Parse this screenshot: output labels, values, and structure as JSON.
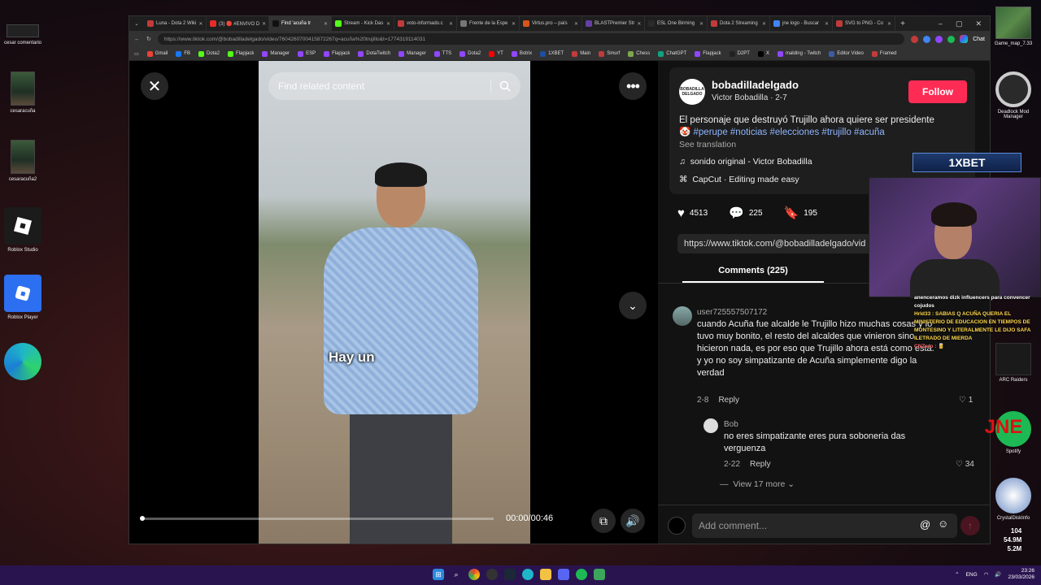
{
  "desktop": {
    "icons": [
      {
        "label": "cesar comentario"
      },
      {
        "label": "cesaracuña"
      },
      {
        "label": "cesaracuña2"
      },
      {
        "label": "Roblox Studio"
      },
      {
        "label": "Roblox Player"
      },
      {
        "label": "Game_map_7.33"
      },
      {
        "label": "Deadlock Mod Manager"
      },
      {
        "label": "ARC Raiders"
      },
      {
        "label": "Spotify"
      },
      {
        "label": "CrystalDiskInfo"
      }
    ]
  },
  "browser": {
    "tabs": [
      {
        "label": "Luna - Dota 2 Wiki",
        "color": "#c23b3b"
      },
      {
        "label": "(3) 🔴 #ENVIVO D",
        "color": "#e52d27"
      },
      {
        "label": "Find 'acuña tr",
        "color": "#111111",
        "active": true
      },
      {
        "label": "Stream - Kick Das",
        "color": "#53fc18"
      },
      {
        "label": "voto-informado.c",
        "color": "#c23b3b"
      },
      {
        "label": "Frente de la Espe",
        "color": "#777777"
      },
      {
        "label": "Virtus.pro – país",
        "color": "#d7541c"
      },
      {
        "label": "BLASTPremier Str",
        "color": "#6441a5"
      },
      {
        "label": "ESL One Birming",
        "color": "#2a2a2a"
      },
      {
        "label": "Dota 2 Streaming",
        "color": "#c23b3b"
      },
      {
        "label": "jne logo - Buscar",
        "color": "#4285f4"
      },
      {
        "label": "SVG to PNG - Co",
        "color": "#c23b3b"
      }
    ],
    "url": "https://www.tiktok.com/@bobadilladelgado/video/7604260700415872267q=acuña%20trujillo&t=1774319114031",
    "chat_label": "Chat",
    "bookmarks": [
      {
        "label": "Gmail",
        "color": "#ea4335"
      },
      {
        "label": "FB",
        "color": "#1877f2"
      },
      {
        "label": "Dota2",
        "color": "#53fc18"
      },
      {
        "label": "Flapjack",
        "color": "#53fc18"
      },
      {
        "label": "Manager",
        "color": "#9146ff"
      },
      {
        "label": "ESP",
        "color": "#9146ff"
      },
      {
        "label": "Flapjack",
        "color": "#9146ff"
      },
      {
        "label": "DotaTwitch",
        "color": "#9146ff"
      },
      {
        "label": "Manager",
        "color": "#9146ff"
      },
      {
        "label": "TTS",
        "color": "#9146ff"
      },
      {
        "label": "Dota2",
        "color": "#9146ff"
      },
      {
        "label": "YT",
        "color": "#ff0000"
      },
      {
        "label": "Botrix",
        "color": "#9146ff"
      },
      {
        "label": "1XBET",
        "color": "#1e4fa0"
      },
      {
        "label": "Main",
        "color": "#c23b3b"
      },
      {
        "label": "Smurf",
        "color": "#c23b3b"
      },
      {
        "label": "Chess",
        "color": "#7fa650"
      },
      {
        "label": "ChatGPT",
        "color": "#10a37f"
      },
      {
        "label": "Flapjack",
        "color": "#9146ff"
      },
      {
        "label": "D2PT",
        "color": "#222222"
      },
      {
        "label": "X",
        "color": "#000000"
      },
      {
        "label": "malding - Twitch",
        "color": "#9146ff"
      },
      {
        "label": "Editor Video",
        "color": "#3b5ba5"
      },
      {
        "label": "Framed",
        "color": "#c23b3b"
      }
    ]
  },
  "video": {
    "search_placeholder": "Find related content",
    "caption": "Hay un",
    "time": "00:00/00:46",
    "progress_fraction": 0.0
  },
  "post": {
    "username": "bobadilladelgado",
    "display_name": "Victor Bobadilla",
    "date": "2-7",
    "follow_label": "Follow",
    "avatar_text": "BOBADILLA DELGADO",
    "description": "El personaje que destruyó Trujillo ahora quiere ser presidente",
    "hashtags": "🤡 #perupe #noticias #elecciones #trujillo #acuña",
    "see_translation": "See translation",
    "music": "sonido original - Victor Bobadilla",
    "capcut": "CapCut · Editing made easy",
    "likes": "4513",
    "comments_count": "225",
    "saves": "195",
    "link": "https://www.tiktok.com/@bobadilladelgado/vid",
    "comments_tab": "Comments (225)"
  },
  "comments": [
    {
      "user": "user725557507172",
      "text": "cuando Acuña fue alcalde le Trujillo hizo muchas cosas y lo tuvo muy bonito, el resto del alcaldes que vinieron sino hicieron nada, es por eso que Trujillo ahora está como está.\ny yo no soy simpatizante de Acuña simplemente digo la verdad",
      "date": "2-8",
      "reply": "Reply",
      "likes": "1"
    },
    {
      "user": "Bob",
      "text": "no eres simpatizante eres pura soboneria das verguenza",
      "date": "2-22",
      "reply": "Reply",
      "likes": "34"
    }
  ],
  "view_more": "View 17 more",
  "add_comment_placeholder": "Add comment...",
  "overlay": {
    "bet_label": "1XBET",
    "chat_lines": [
      "anenceramos dizk influencers para convencer cojudos",
      "Hrld33 : SABIAS Q ACUÑA QUERIA EL MINISTERIO DE EDUCACION EN TIEMPOS DE MONTESINO Y LITERALMENTE LE DIJO SAFA ILETRADO DE MIERDA",
      "CNZero : 🥫"
    ],
    "jne_label": "JNE",
    "stats": [
      "104",
      "54.9M",
      "5.2M"
    ]
  },
  "taskbar": {
    "lang": "ENG",
    "time": "23:26",
    "date": "23/03/2026"
  }
}
